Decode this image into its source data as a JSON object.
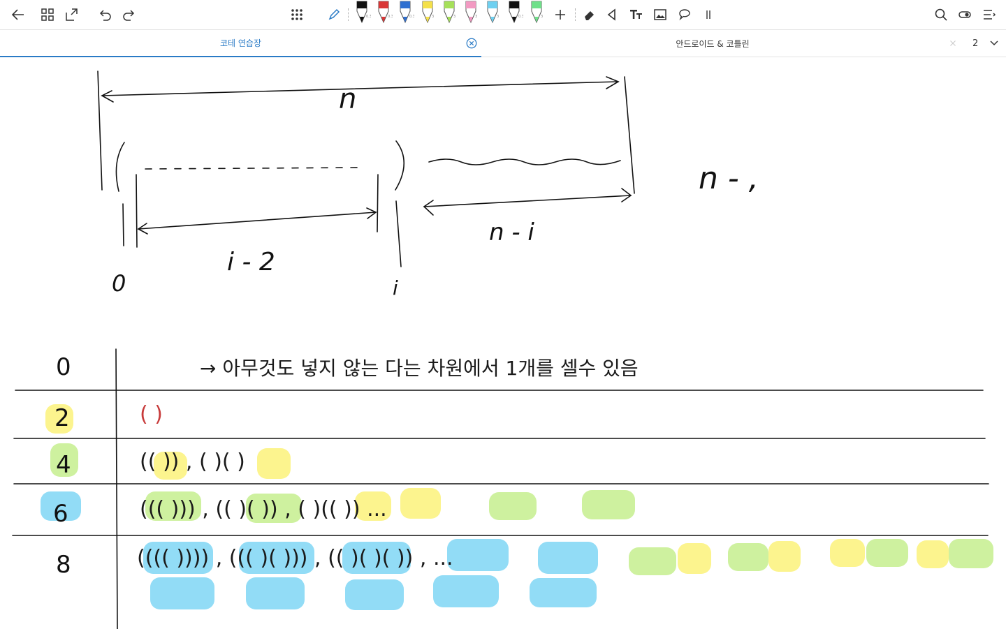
{
  "toolbar": {
    "left_icons": [
      "back-arrow-icon",
      "grid-view-icon",
      "export-icon",
      "undo-icon",
      "redo-icon"
    ],
    "center_icons": [
      "apps-grid-icon",
      "pen-tool-icon"
    ],
    "pens": [
      {
        "color": "#111111",
        "size": "0.3"
      },
      {
        "color": "#d93636",
        "size": "0.3"
      },
      {
        "color": "#2f6fd0",
        "size": "0.3"
      },
      {
        "color": "#f4e04a",
        "size": "3"
      },
      {
        "color": "#a6e05a",
        "size": "3"
      },
      {
        "color": "#f29ac2",
        "size": "3"
      },
      {
        "color": "#6fd0f0",
        "size": "3"
      },
      {
        "color": "#111111",
        "size": "0.3"
      },
      {
        "color": "#6fe08a",
        "size": "3"
      }
    ],
    "tools": [
      "add-icon",
      "eraser-icon",
      "lasso-shape-icon",
      "text-tool-icon",
      "image-icon",
      "comment-icon",
      "pause-icon"
    ],
    "right_icons": [
      "search-icon",
      "toggle-icon",
      "menu-icon"
    ]
  },
  "tabs": {
    "active_label": "코테 연습장",
    "inactive_label": "안드로이드 & 코틀린",
    "count": "2"
  },
  "colors": {
    "accent": "#2a7bc6",
    "ink": "#111111",
    "red_ink": "#c73a3a",
    "highlight_yellow": "#fbf27a",
    "highlight_green": "#c6ef8e",
    "highlight_blue": "#7fd6f5"
  },
  "notes": {
    "top_diagram": {
      "n_label": "n",
      "zero_label": "0",
      "i_label": "i",
      "i_minus_2": "i - 2",
      "n_minus_i": "n - i",
      "side_note": "n - ,"
    },
    "table": {
      "rows": [
        {
          "n": "0",
          "content": "→ 아무것도 넣지 않는 다는 차원에서 1개를 셀수 있음"
        },
        {
          "n": "2",
          "content": "( )"
        },
        {
          "n": "4",
          "content": "(( )) , ( )( )"
        },
        {
          "n": "6",
          "content": "((( ))) , (( )( )) , ( )(( )) ... "
        },
        {
          "n": "8",
          "content": "(((( )))) , ((( )( ))) , (( )( )( )) , ..."
        }
      ]
    }
  }
}
